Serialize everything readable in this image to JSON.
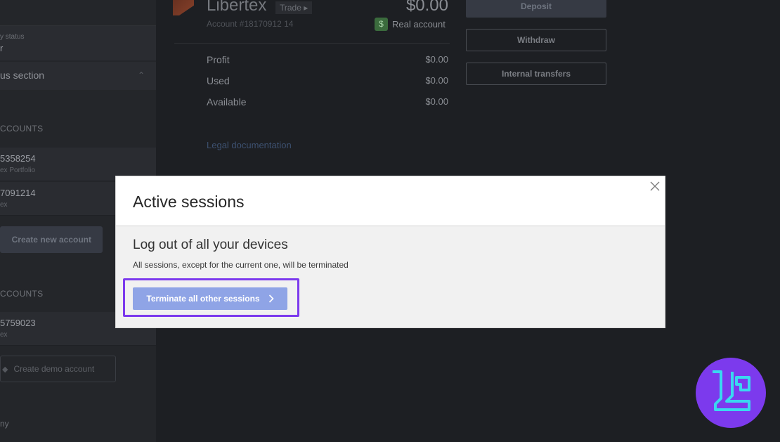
{
  "sidebar": {
    "status_label": "y status",
    "status_value": "r",
    "section_label": "us section",
    "section_chevron": "⌃",
    "real_heading": "CCOUNTS",
    "real_accounts": [
      {
        "number": "5358254",
        "subtitle": "ex Portfolio"
      },
      {
        "number": "7091214",
        "subtitle": "ex"
      }
    ],
    "create_new_label": "Create new account",
    "demo_heading": "CCOUNTS",
    "demo_accounts": [
      {
        "number": "5759023",
        "subtitle": "ex"
      }
    ],
    "create_demo_label": "Create demo account",
    "company_label": "ny"
  },
  "account": {
    "brand": "Libertex",
    "trade_label": "Trade ▸",
    "account_number": "Account #18170912 14",
    "balance": "$0.00",
    "real_badge": "$",
    "real_label": "Real account",
    "stats": [
      {
        "label": "Profit",
        "value": "$0.00"
      },
      {
        "label": "Used",
        "value": "$0.00"
      },
      {
        "label": "Available",
        "value": "$0.00"
      }
    ],
    "legal_link": "Legal documentation"
  },
  "actions": {
    "deposit": "Deposit",
    "withdraw": "Withdraw",
    "internal": "Internal transfers"
  },
  "modal": {
    "title": "Active sessions",
    "subtitle": "Log out of all your devices",
    "description": "All sessions, except for the current one, will be terminated",
    "terminate_label": "Terminate all other sessions"
  },
  "colors": {
    "highlight": "#7c3aed",
    "button": "#8fa4e6",
    "watermark_bg": "#7c3aed",
    "watermark_fg": "#3ad8f0"
  }
}
